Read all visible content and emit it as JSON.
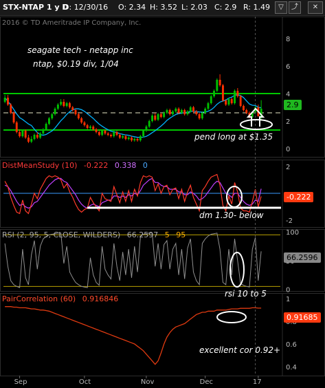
{
  "header": {
    "symbol": "STX-NTAP 1 y D",
    "date": "D: 12/30/16",
    "open": "O: 2.34",
    "high": "H: 3.52",
    "low": "L: 2.03",
    "close": "C: 2.9",
    "range": "R: 1.49"
  },
  "copyright": "2016 © TD Ameritrade IP Company, Inc.",
  "annotations": {
    "line1": "seagate tech - netapp inc",
    "line2": "ntap, $0.19 div, 1/04",
    "pend": "pend long at $1.35",
    "dm": "dm 1.30- below",
    "rsi": "rsi 10 to 5",
    "cor": "excellent cor 0.92+"
  },
  "studies": {
    "dms": {
      "name": "DistMeanStudy (10)",
      "v1": "-0.222",
      "v2": "0.338",
      "v3": "0"
    },
    "rsi": {
      "name": "RSI (2, 95, 5, CLOSE, WILDERS)",
      "v1": "66.2597",
      "v2": "5",
      "v3": "95"
    },
    "pc": {
      "name": "PairCorrelation (60)",
      "v1": "0.916846"
    }
  },
  "tags": {
    "price": "2.9",
    "dms": "-0.222",
    "rsi": "66.2596",
    "pc": "0.91685"
  },
  "colors": {
    "up": "#00c000",
    "down": "#ff3000",
    "green_line": "#00c800",
    "ma": "#00b4ff",
    "dms": "#c040ff",
    "rsi_line": "#909090",
    "corr": "#e03a10"
  },
  "chart_data": [
    {
      "type": "candlestick",
      "title": "STX-NTAP 1 y D",
      "x": [
        "2016-08-26",
        "2016-08-29",
        "2016-08-30",
        "2016-08-31",
        "2016-09-01",
        "2016-09-02",
        "2016-09-06",
        "2016-09-07",
        "2016-09-08",
        "2016-09-09",
        "2016-09-12",
        "2016-09-13",
        "2016-09-14",
        "2016-09-15",
        "2016-09-16",
        "2016-09-19",
        "2016-09-20",
        "2016-09-21",
        "2016-09-22",
        "2016-09-23",
        "2016-09-26",
        "2016-09-27",
        "2016-09-28",
        "2016-09-29",
        "2016-09-30",
        "2016-10-03",
        "2016-10-04",
        "2016-10-05",
        "2016-10-06",
        "2016-10-07",
        "2016-10-10",
        "2016-10-11",
        "2016-10-12",
        "2016-10-13",
        "2016-10-14",
        "2016-10-17",
        "2016-10-18",
        "2016-10-19",
        "2016-10-20",
        "2016-10-21",
        "2016-10-24",
        "2016-10-25",
        "2016-10-26",
        "2016-10-27",
        "2016-10-28",
        "2016-10-31",
        "2016-11-01",
        "2016-11-02",
        "2016-11-03",
        "2016-11-04",
        "2016-11-07",
        "2016-11-08",
        "2016-11-09",
        "2016-11-10",
        "2016-11-11",
        "2016-11-14",
        "2016-11-15",
        "2016-11-16",
        "2016-11-17",
        "2016-11-18",
        "2016-11-21",
        "2016-11-22",
        "2016-11-23",
        "2016-11-25",
        "2016-11-28",
        "2016-11-29",
        "2016-11-30",
        "2016-12-01",
        "2016-12-02",
        "2016-12-05",
        "2016-12-06",
        "2016-12-07",
        "2016-12-08",
        "2016-12-09",
        "2016-12-12",
        "2016-12-13",
        "2016-12-14",
        "2016-12-15",
        "2016-12-16",
        "2016-12-19",
        "2016-12-20",
        "2016-12-21",
        "2016-12-22",
        "2016-12-23",
        "2016-12-27",
        "2016-12-28",
        "2016-12-29",
        "2016-12-30"
      ],
      "open": [
        3.4,
        3.7,
        3.2,
        2.6,
        1.9,
        1.2,
        0.9,
        1.3,
        0.8,
        0.5,
        0.7,
        1.0,
        0.8,
        1.1,
        1.4,
        1.8,
        2.2,
        2.5,
        2.9,
        3.2,
        3.4,
        3.1,
        3.3,
        3.0,
        2.8,
        2.5,
        2.2,
        1.9,
        1.7,
        1.5,
        1.6,
        1.4,
        1.2,
        1.0,
        1.3,
        1.1,
        1.0,
        0.9,
        1.2,
        1.0,
        0.8,
        0.9,
        0.7,
        0.8,
        0.6,
        0.7,
        0.6,
        0.9,
        1.3,
        1.6,
        2.0,
        2.4,
        2.1,
        2.5,
        2.3,
        2.6,
        2.8,
        2.5,
        2.7,
        2.9,
        2.6,
        2.8,
        2.5,
        2.7,
        3.0,
        2.7,
        2.5,
        2.2,
        2.6,
        2.9,
        3.3,
        3.8,
        4.2,
        5.0,
        4.6,
        3.5,
        3.2,
        3.6,
        3.3,
        4.2,
        3.8,
        3.1,
        2.8,
        2.6,
        2.3,
        2.6,
        3.0,
        2.34
      ],
      "high": [
        3.9,
        3.9,
        3.3,
        2.7,
        2.0,
        1.4,
        1.4,
        1.4,
        1.0,
        0.9,
        1.1,
        1.2,
        1.2,
        1.5,
        1.9,
        2.3,
        2.6,
        3.0,
        3.3,
        3.6,
        3.6,
        3.4,
        3.4,
        3.1,
        2.9,
        2.6,
        2.3,
        2.0,
        1.8,
        1.7,
        1.7,
        1.5,
        1.3,
        1.4,
        1.4,
        1.2,
        1.1,
        1.3,
        1.3,
        1.1,
        1.0,
        1.0,
        0.9,
        0.9,
        0.8,
        0.8,
        1.0,
        1.4,
        1.7,
        2.1,
        2.5,
        2.6,
        2.6,
        2.6,
        2.7,
        2.9,
        2.9,
        2.8,
        3.0,
        3.0,
        2.9,
        2.9,
        2.8,
        3.1,
        3.1,
        2.8,
        2.6,
        2.7,
        3.0,
        3.4,
        3.9,
        4.3,
        5.1,
        5.4,
        4.7,
        3.6,
        3.7,
        3.7,
        4.3,
        4.4,
        3.9,
        3.2,
        2.9,
        2.7,
        2.7,
        3.1,
        3.2,
        3.52
      ],
      "low": [
        3.3,
        3.1,
        2.5,
        1.8,
        1.1,
        0.8,
        0.8,
        0.7,
        0.4,
        0.4,
        0.6,
        0.7,
        0.7,
        1.0,
        1.3,
        1.7,
        2.1,
        2.4,
        2.8,
        3.1,
        3.0,
        3.0,
        2.9,
        2.7,
        2.4,
        2.1,
        1.8,
        1.6,
        1.4,
        1.4,
        1.3,
        1.1,
        0.9,
        0.9,
        1.0,
        0.9,
        0.8,
        0.8,
        0.9,
        0.7,
        0.7,
        0.6,
        0.6,
        0.5,
        0.5,
        0.5,
        0.5,
        0.8,
        1.2,
        1.5,
        1.9,
        2.0,
        2.0,
        2.2,
        2.2,
        2.5,
        2.4,
        2.4,
        2.6,
        2.5,
        2.5,
        2.4,
        2.4,
        2.6,
        2.6,
        2.4,
        2.1,
        2.1,
        2.5,
        2.8,
        3.2,
        3.7,
        4.1,
        4.5,
        3.4,
        3.1,
        3.1,
        3.2,
        3.2,
        3.7,
        3.0,
        2.7,
        2.5,
        2.2,
        2.2,
        2.5,
        2.6,
        2.03
      ],
      "close": [
        3.7,
        3.2,
        2.6,
        1.9,
        1.2,
        0.9,
        1.3,
        0.8,
        0.5,
        0.7,
        1.0,
        0.8,
        1.1,
        1.4,
        1.8,
        2.2,
        2.5,
        2.9,
        3.2,
        3.4,
        3.1,
        3.3,
        3.0,
        2.8,
        2.5,
        2.2,
        1.9,
        1.7,
        1.5,
        1.6,
        1.4,
        1.2,
        1.0,
        1.3,
        1.1,
        1.0,
        0.9,
        1.2,
        1.0,
        0.8,
        0.9,
        0.7,
        0.8,
        0.6,
        0.7,
        0.6,
        0.9,
        1.3,
        1.6,
        2.0,
        2.4,
        2.1,
        2.5,
        2.3,
        2.6,
        2.8,
        2.5,
        2.7,
        2.9,
        2.6,
        2.8,
        2.5,
        2.7,
        3.0,
        2.7,
        2.5,
        2.2,
        2.6,
        2.9,
        3.3,
        3.8,
        4.2,
        5.0,
        4.6,
        3.5,
        3.2,
        3.6,
        3.3,
        4.2,
        3.8,
        3.1,
        2.8,
        2.6,
        2.3,
        2.6,
        3.0,
        2.34,
        2.9
      ],
      "ylim": [
        -0.6,
        9.6
      ],
      "yticks": [
        0,
        2,
        4,
        6,
        8
      ],
      "xticks": [
        "Sep",
        "Oct",
        "Nov",
        "Dec",
        "17"
      ],
      "hlines": [
        4,
        2.6,
        1.35
      ],
      "grid": false
    },
    {
      "type": "line",
      "title": "DistMeanStudy (10)",
      "series": [
        {
          "name": "DistMeanStudy",
          "values": [
            0.9,
            0.5,
            -0.3,
            -0.9,
            -1.4,
            -1.5,
            -0.5,
            -1.3,
            -1.5,
            -0.8,
            0.0,
            -0.4,
            0.3,
            0.7,
            1.1,
            1.3,
            1.2,
            1.3,
            1.2,
            1.0,
            0.4,
            0.7,
            0.1,
            -0.3,
            -0.8,
            -1.2,
            -1.4,
            -1.2,
            -1.1,
            -0.3,
            -0.7,
            -1.0,
            -1.3,
            0.0,
            -0.4,
            -0.5,
            -0.6,
            0.5,
            -0.1,
            -0.7,
            0.1,
            -0.6,
            0.2,
            -0.6,
            0.3,
            -0.2,
            0.8,
            1.3,
            1.2,
            1.3,
            1.2,
            0.2,
            0.7,
            0.0,
            0.5,
            0.6,
            -0.1,
            0.3,
            0.4,
            -0.4,
            0.3,
            -0.6,
            0.1,
            0.6,
            -0.3,
            -0.8,
            -1.3,
            0.2,
            0.5,
            0.9,
            1.2,
            1.3,
            1.4,
            0.6,
            -0.9,
            -1.3,
            -0.2,
            -0.8,
            0.8,
            0.1,
            -1.1,
            -1.3,
            -1.3,
            -1.4,
            -0.6,
            0.3,
            -1.0,
            -0.222
          ]
        },
        {
          "name": "Signal",
          "values": [
            0.6,
            0.5,
            0.2,
            -0.2,
            -0.6,
            -0.9,
            -0.8,
            -1.0,
            -1.1,
            -1.0,
            -0.7,
            -0.6,
            -0.3,
            0.0,
            0.3,
            0.6,
            0.8,
            1.0,
            1.1,
            1.1,
            0.9,
            0.8,
            0.5,
            0.2,
            -0.1,
            -0.5,
            -0.8,
            -1.0,
            -1.1,
            -0.9,
            -0.8,
            -0.9,
            -1.0,
            -0.7,
            -0.6,
            -0.5,
            -0.5,
            -0.2,
            -0.2,
            -0.3,
            -0.2,
            -0.3,
            -0.1,
            -0.2,
            0.0,
            -0.1,
            0.2,
            0.6,
            0.8,
            1.0,
            1.1,
            0.8,
            0.8,
            0.6,
            0.5,
            0.5,
            0.3,
            0.3,
            0.3,
            0.1,
            0.1,
            -0.1,
            -0.1,
            0.1,
            0.0,
            -0.2,
            -0.5,
            -0.4,
            -0.2,
            0.1,
            0.4,
            0.7,
            0.9,
            0.8,
            0.4,
            0.0,
            -0.1,
            -0.3,
            0.0,
            0.0,
            -0.3,
            -0.6,
            -0.8,
            -0.9,
            -0.8,
            -0.5,
            -0.6,
            0.338
          ]
        }
      ],
      "ylim": [
        -2.5,
        2.5
      ],
      "yticks": [
        -2,
        2
      ],
      "hlines": [
        0,
        -1.3
      ]
    },
    {
      "type": "line",
      "title": "RSI (2, 95, 5, CLOSE, WILDERS)",
      "series": [
        {
          "name": "RSI",
          "values": [
            80,
            40,
            15,
            8,
            5,
            3,
            70,
            20,
            8,
            60,
            85,
            35,
            75,
            88,
            92,
            95,
            96,
            97,
            98,
            98,
            45,
            75,
            30,
            20,
            12,
            8,
            5,
            4,
            3,
            55,
            25,
            12,
            7,
            75,
            35,
            25,
            18,
            80,
            40,
            15,
            65,
            25,
            70,
            20,
            75,
            30,
            92,
            96,
            97,
            98,
            98,
            40,
            80,
            35,
            78,
            85,
            35,
            70,
            80,
            25,
            70,
            18,
            72,
            88,
            30,
            15,
            8,
            80,
            88,
            93,
            96,
            97,
            98,
            70,
            12,
            8,
            70,
            25,
            88,
            50,
            10,
            7,
            5,
            4,
            70,
            90,
            15,
            66.26
          ]
        }
      ],
      "ylim": [
        -3,
        105
      ],
      "yticks": [
        0,
        50,
        100
      ],
      "hlines": [
        95,
        5
      ]
    },
    {
      "type": "line",
      "title": "PairCorrelation (60)",
      "series": [
        {
          "name": "PairCorrelation",
          "values": [
            0.93,
            0.93,
            0.93,
            0.925,
            0.925,
            0.92,
            0.92,
            0.92,
            0.915,
            0.91,
            0.91,
            0.905,
            0.9,
            0.9,
            0.895,
            0.89,
            0.88,
            0.87,
            0.86,
            0.85,
            0.84,
            0.83,
            0.82,
            0.81,
            0.8,
            0.79,
            0.78,
            0.77,
            0.76,
            0.75,
            0.74,
            0.73,
            0.72,
            0.71,
            0.7,
            0.69,
            0.68,
            0.67,
            0.66,
            0.65,
            0.64,
            0.63,
            0.62,
            0.61,
            0.6,
            0.58,
            0.56,
            0.54,
            0.51,
            0.48,
            0.45,
            0.42,
            0.45,
            0.52,
            0.6,
            0.66,
            0.7,
            0.73,
            0.75,
            0.76,
            0.77,
            0.78,
            0.8,
            0.82,
            0.84,
            0.86,
            0.87,
            0.88,
            0.88,
            0.89,
            0.89,
            0.89,
            0.9,
            0.9,
            0.9,
            0.9,
            0.905,
            0.91,
            0.91,
            0.91,
            0.915,
            0.915,
            0.915,
            0.915,
            0.92,
            0.92,
            0.917,
            0.917
          ]
        }
      ],
      "ylim": [
        0.32,
        1.05
      ],
      "yticks": [
        0.4,
        0.6,
        0.8,
        1
      ]
    }
  ]
}
